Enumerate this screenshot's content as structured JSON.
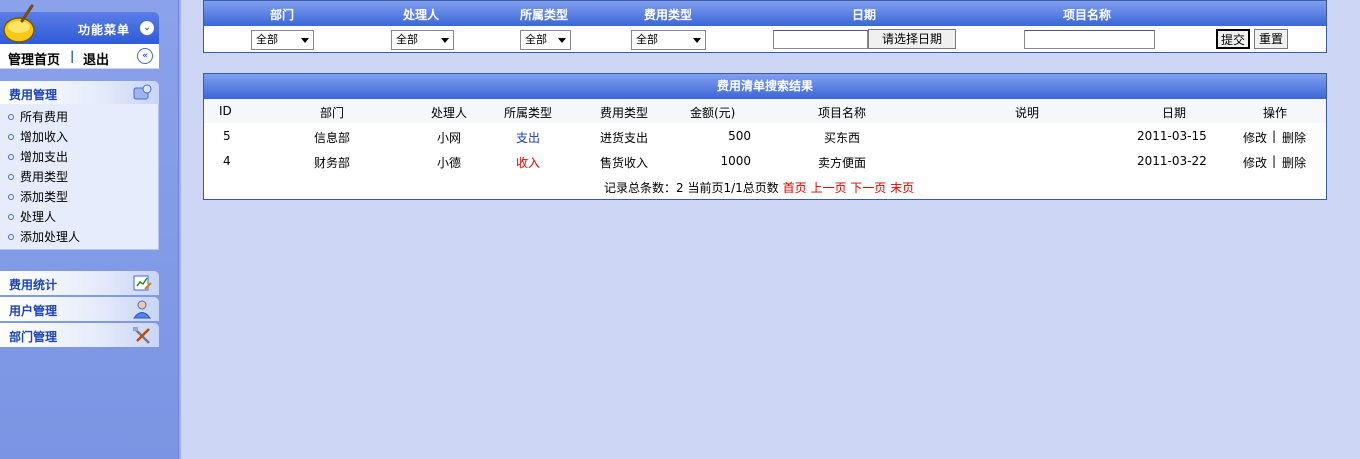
{
  "sidebar": {
    "menu_title": "功能菜单",
    "nav": {
      "home": "管理首页",
      "separator": "|",
      "exit": "退出"
    },
    "cost_panel": {
      "title": "费用管理",
      "items": [
        {
          "label": "所有费用"
        },
        {
          "label": "增加收入"
        },
        {
          "label": "增加支出"
        },
        {
          "label": "费用类型"
        },
        {
          "label": "添加类型"
        },
        {
          "label": "处理人"
        },
        {
          "label": "添加处理人"
        }
      ]
    },
    "stats_panel": {
      "title": "费用统计"
    },
    "user_panel": {
      "title": "用户管理"
    },
    "dept_panel": {
      "title": "部门管理"
    }
  },
  "filter": {
    "headers": {
      "dept": "部门",
      "handler": "处理人",
      "category": "所属类型",
      "cost_type": "费用类型",
      "date": "日期",
      "project": "项目名称"
    },
    "dept_value": "全部",
    "handler_value": "全部",
    "category_value": "全部",
    "cost_type_value": "全部",
    "date_button": "请选择日期",
    "submit_button": "提交",
    "reset_button": "重置"
  },
  "results": {
    "title": "费用清单搜索结果",
    "columns": {
      "id": "ID",
      "dept": "部门",
      "handler": "处理人",
      "category": "所属类型",
      "cost_type": "费用类型",
      "amount": "金额(元)",
      "project": "项目名称",
      "note": "说明",
      "date": "日期",
      "action": "操作"
    },
    "rows": [
      {
        "id": "5",
        "dept": "信息部",
        "handler": "小网",
        "category": "支出",
        "cost_type": "进货支出",
        "amount": "500",
        "project": "买东西",
        "note": "",
        "date": "2011-03-15",
        "edit": "修改",
        "sep": "|",
        "delete": "删除"
      },
      {
        "id": "4",
        "dept": "财务部",
        "handler": "小德",
        "category": "收入",
        "cost_type": "售货收入",
        "amount": "1000",
        "project": "卖方便面",
        "note": "",
        "date": "2011-03-22",
        "edit": "修改",
        "sep": "|",
        "delete": "删除"
      }
    ],
    "pager": {
      "summary": "记录总条数：2 当前页1/1总页数",
      "first": "首页",
      "prev": "上一页",
      "next": "下一页",
      "last": "末页"
    }
  },
  "colors": {
    "expense": "#1a3fb0",
    "income": "#e00000",
    "link": "#e00000",
    "header_blue": "#3c66d6"
  }
}
